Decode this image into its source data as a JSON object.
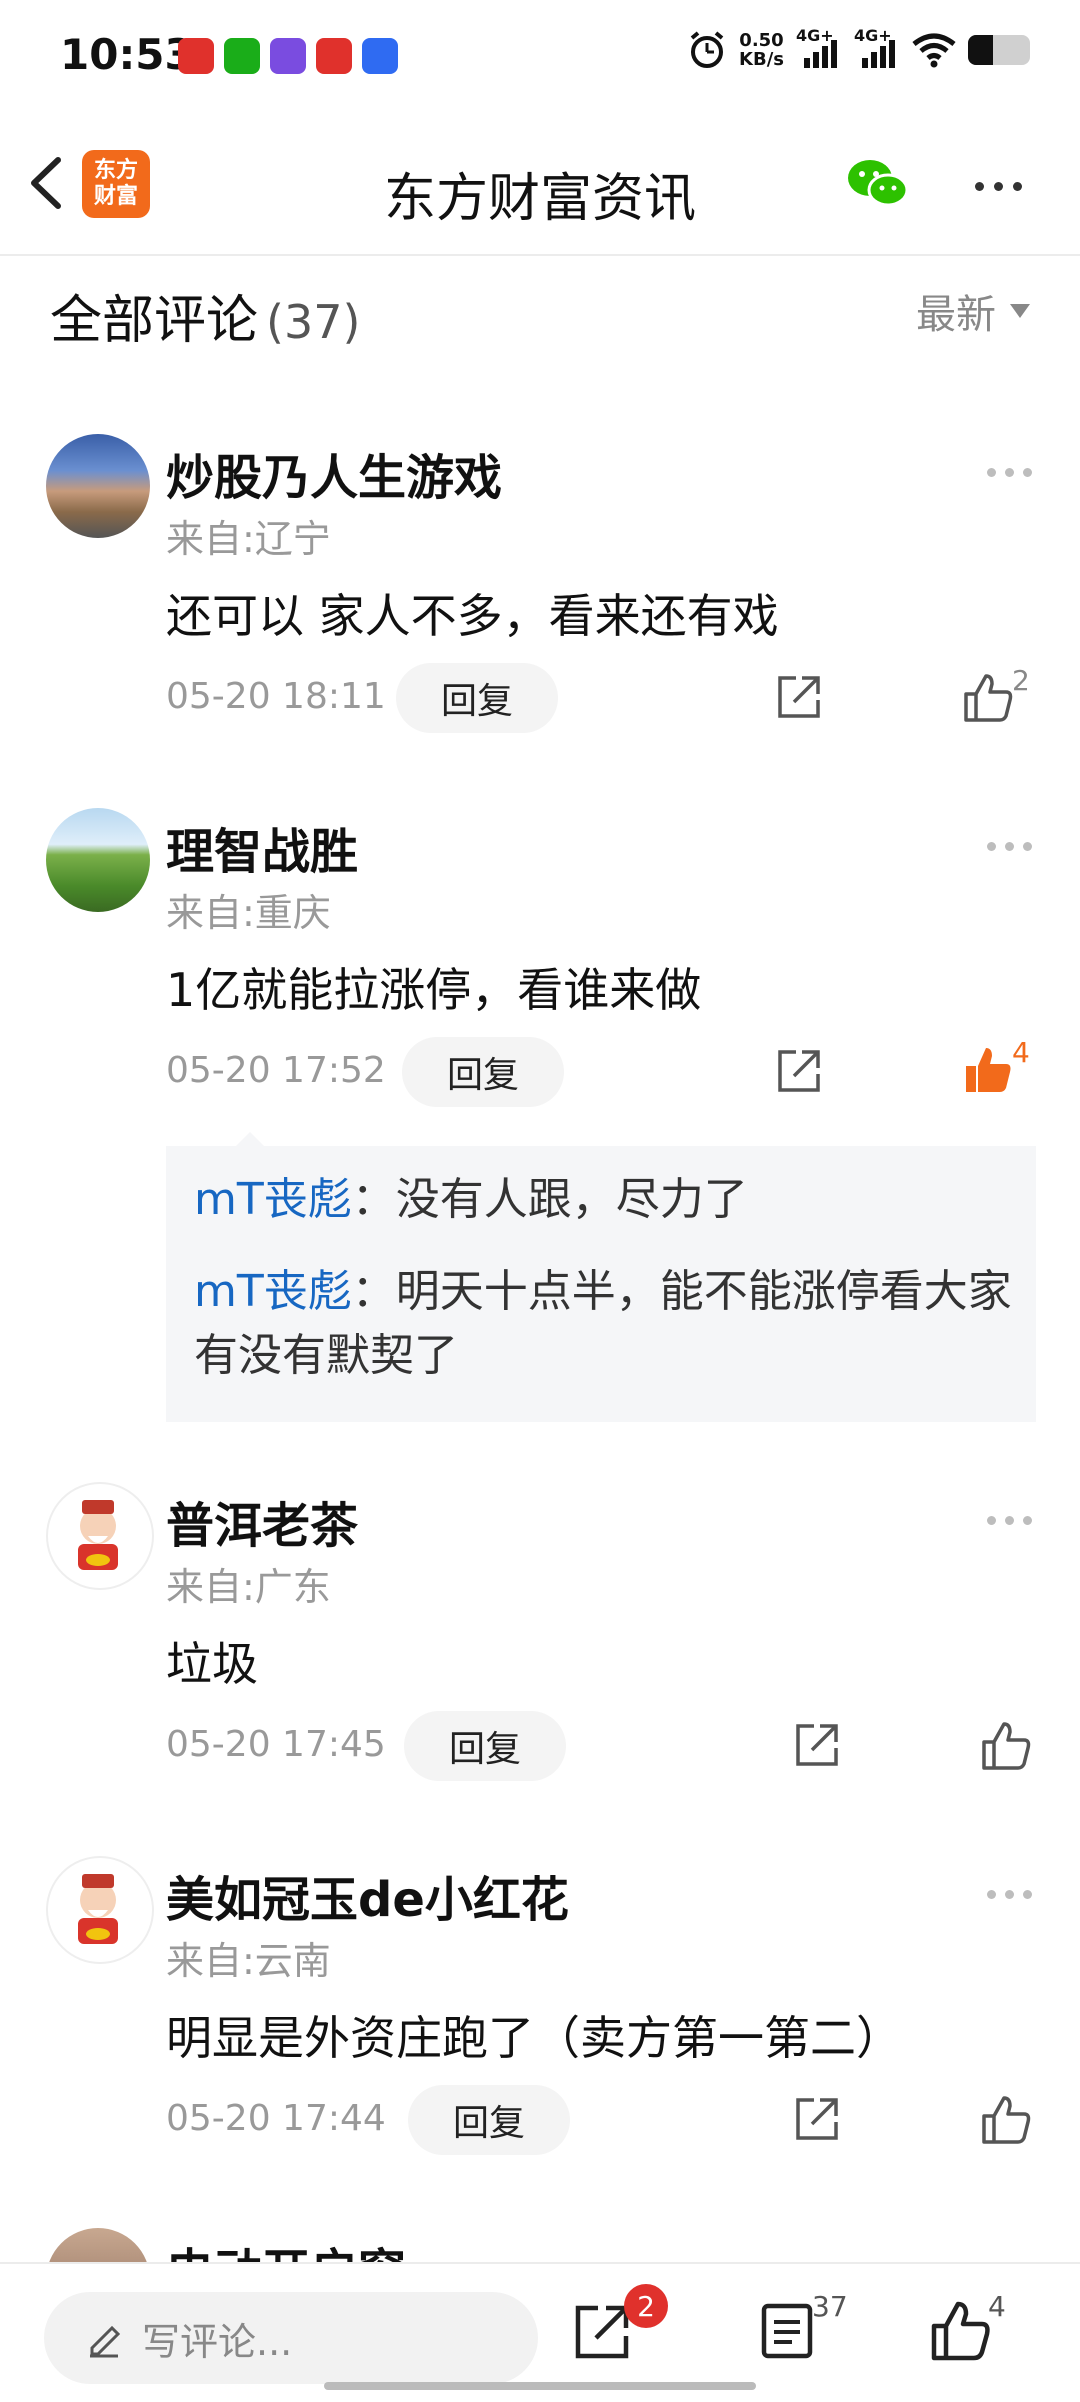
{
  "status_bar": {
    "time": "10:53",
    "net_speed_value": "0.50",
    "net_speed_unit": "KB/s",
    "signal_1": "4G+",
    "signal_2": "4G+",
    "battery_percent": 0.4,
    "apps": [
      {
        "name": "app-1-icon",
        "color": "#e0312c"
      },
      {
        "name": "wechat-app-icon",
        "color": "#1aad19"
      },
      {
        "name": "jd-app-icon",
        "color": "#7a4ce0"
      },
      {
        "name": "stock-app-icon",
        "color": "#e0312c"
      },
      {
        "name": "baidu-app-icon",
        "color": "#2f6bf2"
      }
    ]
  },
  "header": {
    "title": "东方财富资讯",
    "logo_line1": "东方",
    "logo_line2": "财富"
  },
  "comments_header": {
    "title": "全部评论",
    "count": "(37)",
    "sort_label": "最新"
  },
  "comments": [
    {
      "username": "炒股乃人生游戏",
      "location": "来自:辽宁",
      "content": "还可以 家人不多，看来还有戏",
      "time": "05-20 18:11",
      "reply_label": "回复",
      "likes": "2",
      "liked": false
    },
    {
      "username": "理智战胜",
      "location": "来自:重庆",
      "content": "1亿就能拉涨停，看谁来做",
      "time": "05-20 17:52",
      "reply_label": "回复",
      "likes": "4",
      "liked": true,
      "replies": [
        {
          "name": "mT丧彪",
          "text": "：没有人跟，尽力了"
        },
        {
          "name": "mT丧彪",
          "text": "：明天十点半，能不能涨停看大家有没有默契了"
        }
      ]
    },
    {
      "username": "普洱老茶",
      "location": "来自:广东",
      "content": "垃圾",
      "time": "05-20 17:45",
      "reply_label": "回复",
      "likes": "",
      "liked": false
    },
    {
      "username": "美如冠玉de小红花",
      "location": "来自:云南",
      "content": "明显是外资庄跑了（卖方第一第二）",
      "time": "05-20 17:44",
      "reply_label": "回复",
      "likes": "",
      "liked": false
    },
    {
      "username": "电动开启窗"
    }
  ],
  "bottom_bar": {
    "input_placeholder": "写评论...",
    "share_badge": "2",
    "comment_count": "37",
    "like_count": "4"
  },
  "colors": {
    "accent_orange": "#f26a1b",
    "link_blue": "#1767c2",
    "badge_red": "#e0312c"
  }
}
